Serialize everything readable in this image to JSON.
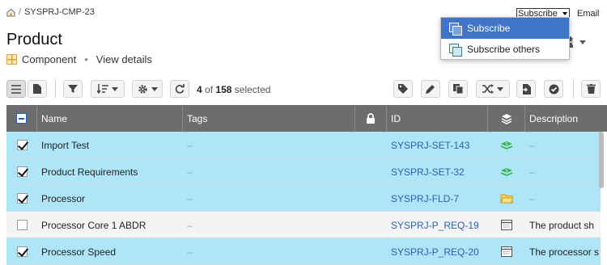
{
  "breadcrumb": {
    "separator": "/",
    "item": "SYSPRJ-CMP-23"
  },
  "page": {
    "title": "Product",
    "type": "Component",
    "separator": "•",
    "view_details": "View details"
  },
  "topright": {
    "subscribe_select": "Subscribe",
    "email": "Email"
  },
  "dropdown": {
    "items": [
      "Subscribe",
      "Subscribe others"
    ],
    "active_index": 0
  },
  "toolbar": {
    "selected_count": "4",
    "selected_of": "of",
    "total": "158",
    "selected_word": "selected"
  },
  "table": {
    "columns": [
      "Name",
      "Tags",
      "",
      "ID",
      "",
      "Description"
    ],
    "rows": [
      {
        "checked": true,
        "name": "Import Test",
        "tags": "–",
        "id": "SYSPRJ-SET-143",
        "type_icon": "set-icon",
        "description": "–"
      },
      {
        "checked": true,
        "name": "Product Requirements",
        "tags": "–",
        "id": "SYSPRJ-SET-32",
        "type_icon": "set-icon",
        "description": "–"
      },
      {
        "checked": true,
        "name": "Processor",
        "tags": "–",
        "id": "SYSPRJ-FLD-7",
        "type_icon": "folder-icon",
        "description": "–"
      },
      {
        "checked": false,
        "name": "Processor Core 1 ABDR",
        "tags": "–",
        "id": "SYSPRJ-P_REQ-19",
        "type_icon": "requirement-icon",
        "description": "The product sh"
      },
      {
        "checked": true,
        "name": "Processor Speed",
        "tags": "–",
        "id": "SYSPRJ-P_REQ-20",
        "type_icon": "requirement-icon",
        "description": "The processor s"
      }
    ]
  },
  "colors": {
    "selected_row": "#aee6f7",
    "header": "#6d6d6d",
    "link": "#2a62b0",
    "dropdown_active": "#3f74c6"
  }
}
